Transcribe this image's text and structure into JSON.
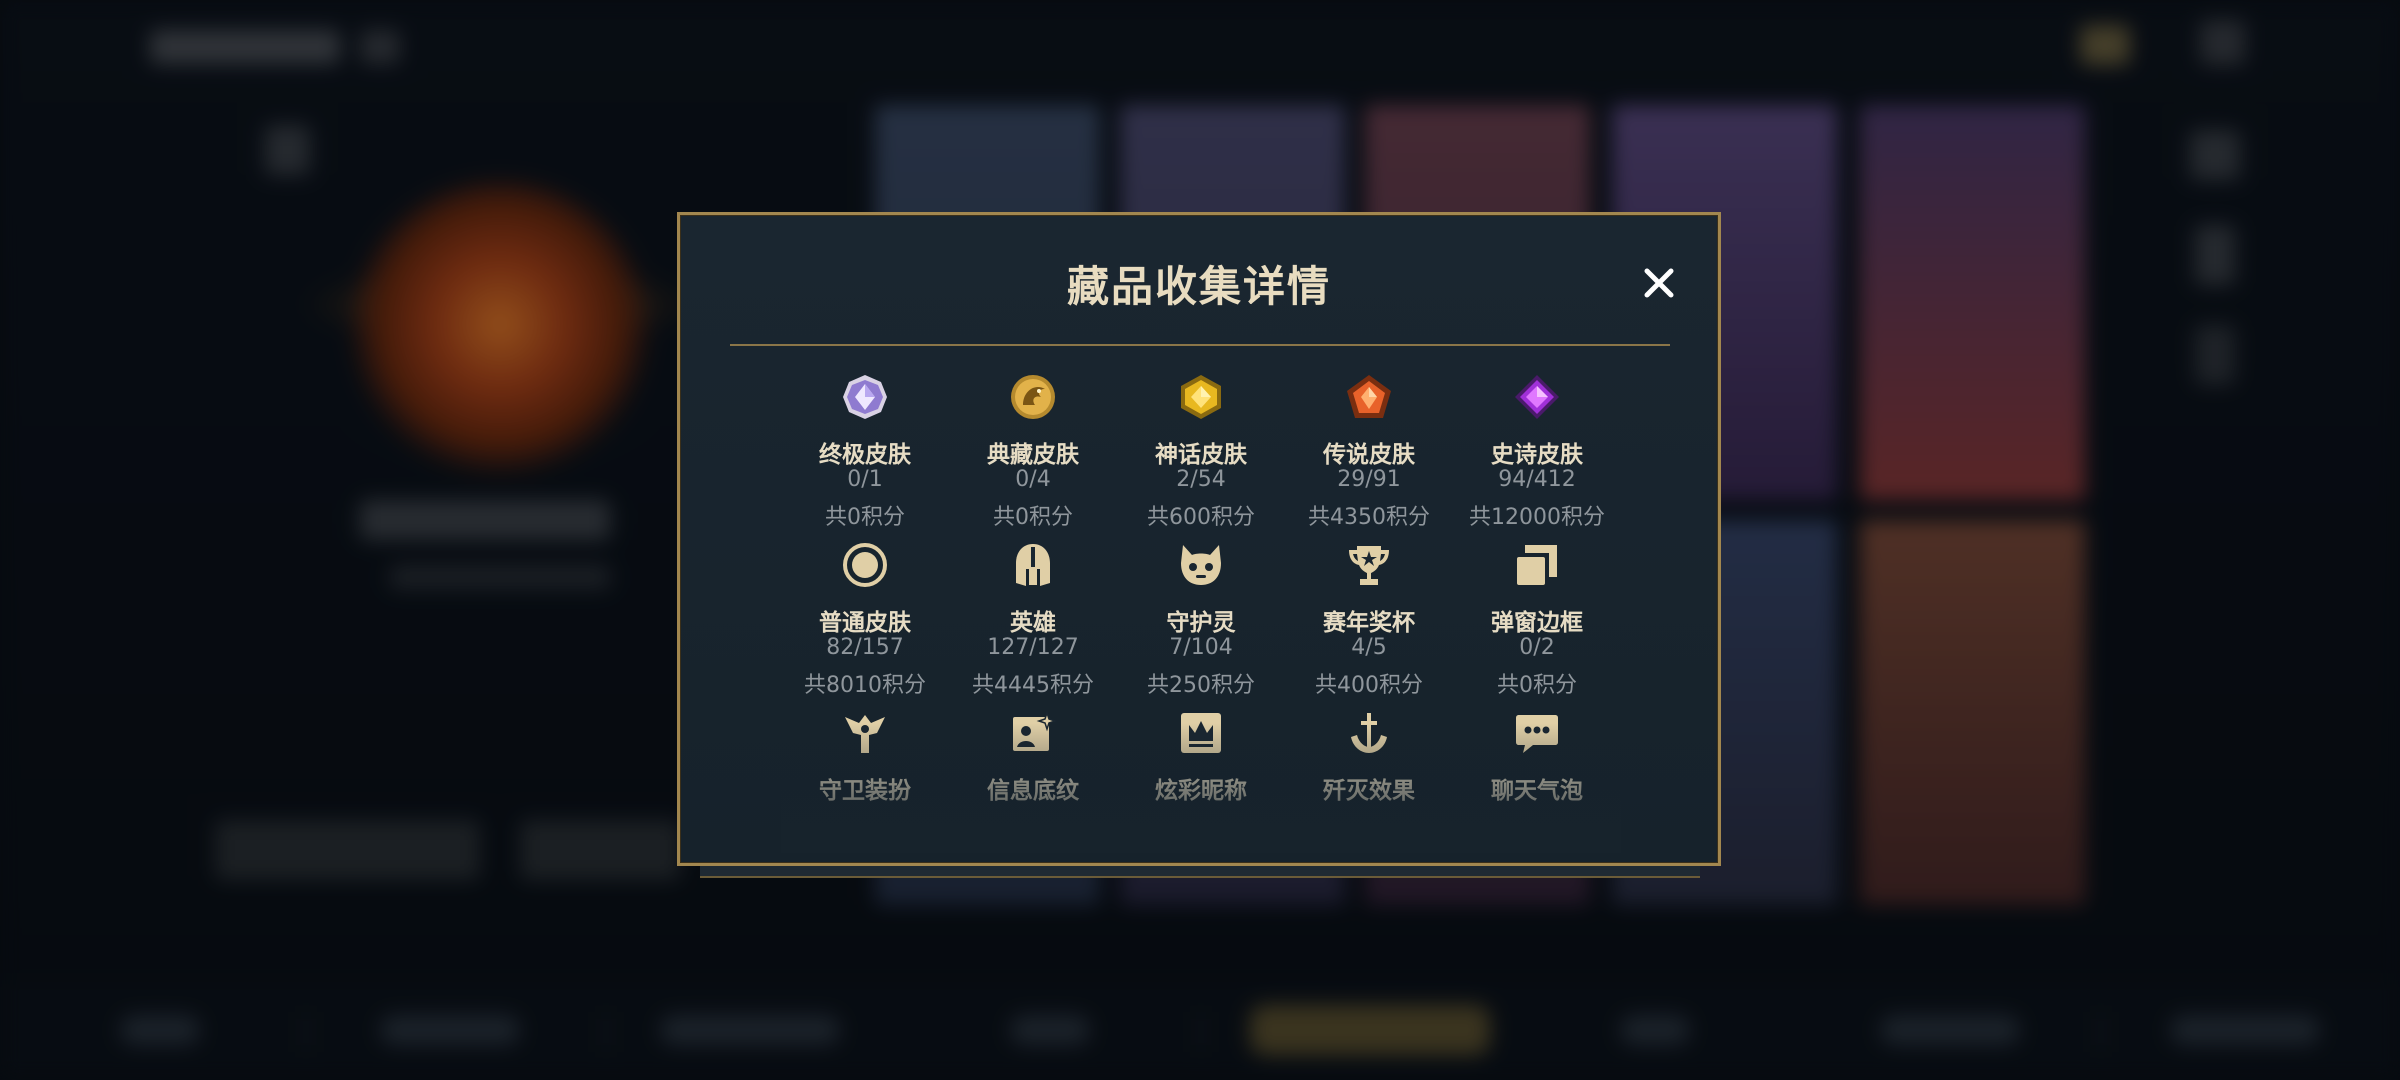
{
  "dialog": {
    "title": "藏品收集详情",
    "close_symbol": "✕",
    "categories": [
      {
        "label": "终极皮肤",
        "count": "0/1",
        "points": "共0积分",
        "icon": "ultimate-gem-icon"
      },
      {
        "label": "典藏皮肤",
        "count": "0/4",
        "points": "共0积分",
        "icon": "dragon-emblem-icon"
      },
      {
        "label": "神话皮肤",
        "count": "2/54",
        "points": "共600积分",
        "icon": "mythic-gem-icon"
      },
      {
        "label": "传说皮肤",
        "count": "29/91",
        "points": "共4350积分",
        "icon": "legendary-gem-icon"
      },
      {
        "label": "史诗皮肤",
        "count": "94/412",
        "points": "共12000积分",
        "icon": "epic-gem-icon"
      },
      {
        "label": "普通皮肤",
        "count": "82/157",
        "points": "共8010积分",
        "icon": "standard-circle-icon"
      },
      {
        "label": "英雄",
        "count": "127/127",
        "points": "共4445积分",
        "icon": "helmet-icon"
      },
      {
        "label": "守护灵",
        "count": "7/104",
        "points": "共250积分",
        "icon": "guardian-creature-icon"
      },
      {
        "label": "赛年奖杯",
        "count": "4/5",
        "points": "共400积分",
        "icon": "trophy-icon"
      },
      {
        "label": "弹窗边框",
        "count": "0/2",
        "points": "共0积分",
        "icon": "stacked-frames-icon"
      },
      {
        "label": "守卫装扮",
        "icon": "ward-icon"
      },
      {
        "label": "信息底纹",
        "icon": "banner-card-icon"
      },
      {
        "label": "炫彩昵称",
        "icon": "crown-nameplate-icon"
      },
      {
        "label": "歼灭效果",
        "icon": "anchor-sword-icon"
      },
      {
        "label": "聊天气泡",
        "icon": "chat-bubble-icon"
      }
    ]
  },
  "colors": {
    "gold_border": "#a2874f",
    "title_text": "#e8dcc0",
    "muted_text": "#8f969c",
    "icon_gold": "#e0cfa6"
  }
}
